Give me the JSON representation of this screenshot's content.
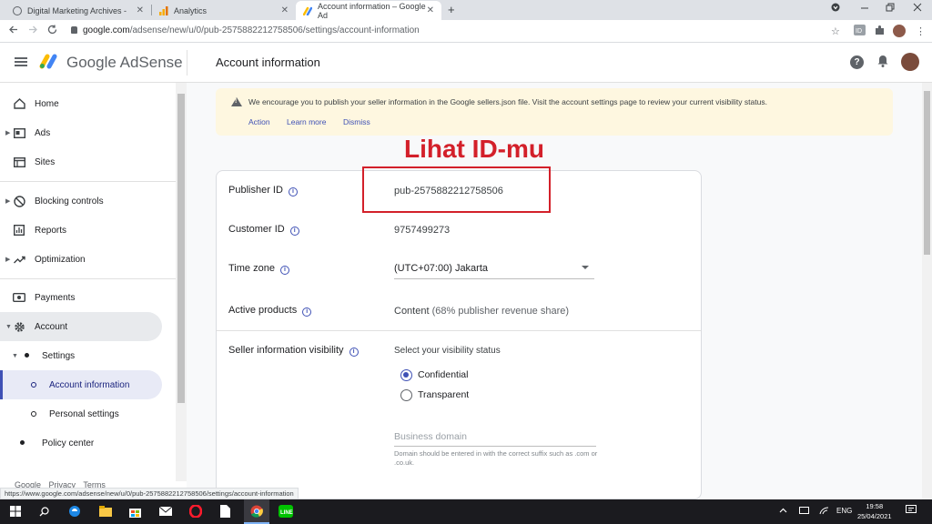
{
  "browser": {
    "tabs": [
      {
        "title": "Digital Marketing Archives -",
        "close": "✕"
      },
      {
        "title": "Analytics",
        "close": "✕"
      },
      {
        "title": "Account information – Google Ad",
        "close": "✕"
      }
    ],
    "new_tab": "+",
    "url_host": "google.com",
    "url_path": "/adsense/new/u/0/pub-2575882212758506/settings/account-information",
    "status_url": "https://www.google.com/adsense/new/u/0/pub-2575882212758506/settings/account-information"
  },
  "header": {
    "brand": "Google AdSense",
    "page_title": "Account information",
    "help_glyph": "?"
  },
  "sidebar": {
    "items": [
      {
        "label": "Home"
      },
      {
        "label": "Ads"
      },
      {
        "label": "Sites"
      },
      {
        "label": "Blocking controls"
      },
      {
        "label": "Reports"
      },
      {
        "label": "Optimization"
      },
      {
        "label": "Payments"
      },
      {
        "label": "Account"
      },
      {
        "label": "Settings"
      },
      {
        "label": "Account information"
      },
      {
        "label": "Personal settings"
      },
      {
        "label": "Policy center"
      }
    ],
    "footer": "Google Privacy Terms"
  },
  "banner": {
    "text": "We encourage you to publish your seller information in the Google sellers.json file. Visit the account settings page to review your current visibility status.",
    "actions": [
      "Action",
      "Learn more",
      "Dismiss"
    ]
  },
  "annotation": "Lihat ID-mu",
  "account": {
    "publisher_id_label": "Publisher ID",
    "publisher_id": "pub-2575882212758506",
    "customer_id_label": "Customer ID",
    "customer_id": "9757499273",
    "timezone_label": "Time zone",
    "timezone": "(UTC+07:00) Jakarta",
    "active_products_label": "Active products",
    "active_products": "Content",
    "active_products_detail": "(68% publisher revenue share)",
    "seller_visibility_label": "Seller information visibility",
    "visibility_prompt": "Select your visibility status",
    "options": [
      "Confidential",
      "Transparent"
    ],
    "selected_option": "Confidential",
    "business_domain_placeholder": "Business domain",
    "business_domain_helper": "Domain should be entered in with the correct suffix such as .com or .co.uk."
  },
  "taskbar": {
    "lang": "ENG",
    "time": "19:58",
    "date": "25/04/2021"
  },
  "colors": {
    "accent": "#3f51b5",
    "annotation": "#d3202a",
    "banner_bg": "#fef7e0"
  }
}
